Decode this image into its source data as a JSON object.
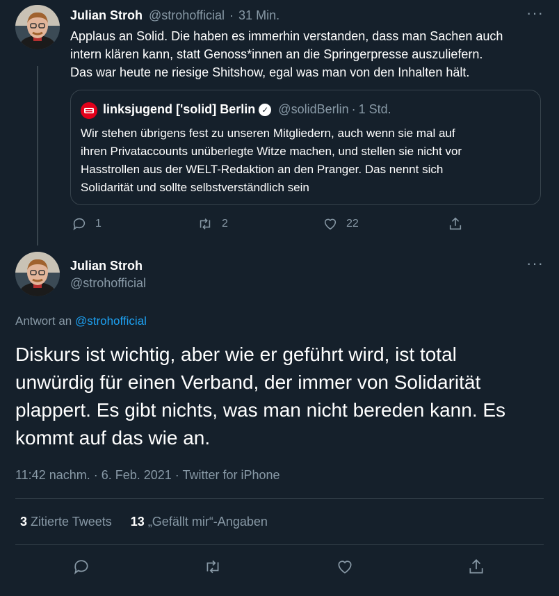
{
  "tweet1": {
    "name": "Julian Stroh",
    "handle": "@strohofficial",
    "sep": "·",
    "time": "31 Min.",
    "text_line1": "Applaus an Solid. Die haben es immerhin verstanden, dass man Sachen auch",
    "text_line2": "intern klären kann, statt Genoss*innen an die Springerpresse auszuliefern.",
    "text_line3": "Das war heute ne riesige Shitshow, egal was man von den Inhalten hält.",
    "quote": {
      "name": "linksjugend ['solid] Berlin",
      "handle": "@solidBerlin",
      "sep": "·",
      "time": "1 Std.",
      "line1": "Wir stehen übrigens fest zu unseren Mitgliedern, auch wenn sie mal auf",
      "line2": "ihren Privataccounts unüberlegte Witze machen, und stellen sie nicht vor",
      "line3": "Hasstrollen aus der WELT-Redaktion an den Pranger. Das nennt sich",
      "line4": "Solidarität und sollte selbstverständlich sein"
    },
    "replies": "1",
    "retweets": "2",
    "likes": "22"
  },
  "tweet2": {
    "name": "Julian Stroh",
    "handle": "@strohofficial",
    "reply_prefix": "Antwort an",
    "reply_to": "@strohofficial",
    "line1": "Diskurs ist wichtig, aber wie er geführt wird, ist total",
    "line2": "unwürdig für einen Verband, der immer von Solidarität",
    "line3": "plappert. Es gibt nichts, was man nicht bereden kann. Es",
    "line4": "kommt auf das wie an.",
    "meta": "11:42 nachm. · 6. Feb. 2021 · Twitter for iPhone",
    "quotes_count": "3",
    "quotes_label": "Zitierte Tweets",
    "likes_count": "13",
    "likes_label": "„Gefällt mir“-Angaben"
  },
  "colors": {
    "background": "#15202b",
    "muted": "#8899a6",
    "border": "#38444d",
    "link": "#1da1f2",
    "brand_red": "#e2001a"
  },
  "icons": [
    "more-icon",
    "reply-icon",
    "retweet-icon",
    "like-icon",
    "share-icon",
    "verified-icon"
  ]
}
